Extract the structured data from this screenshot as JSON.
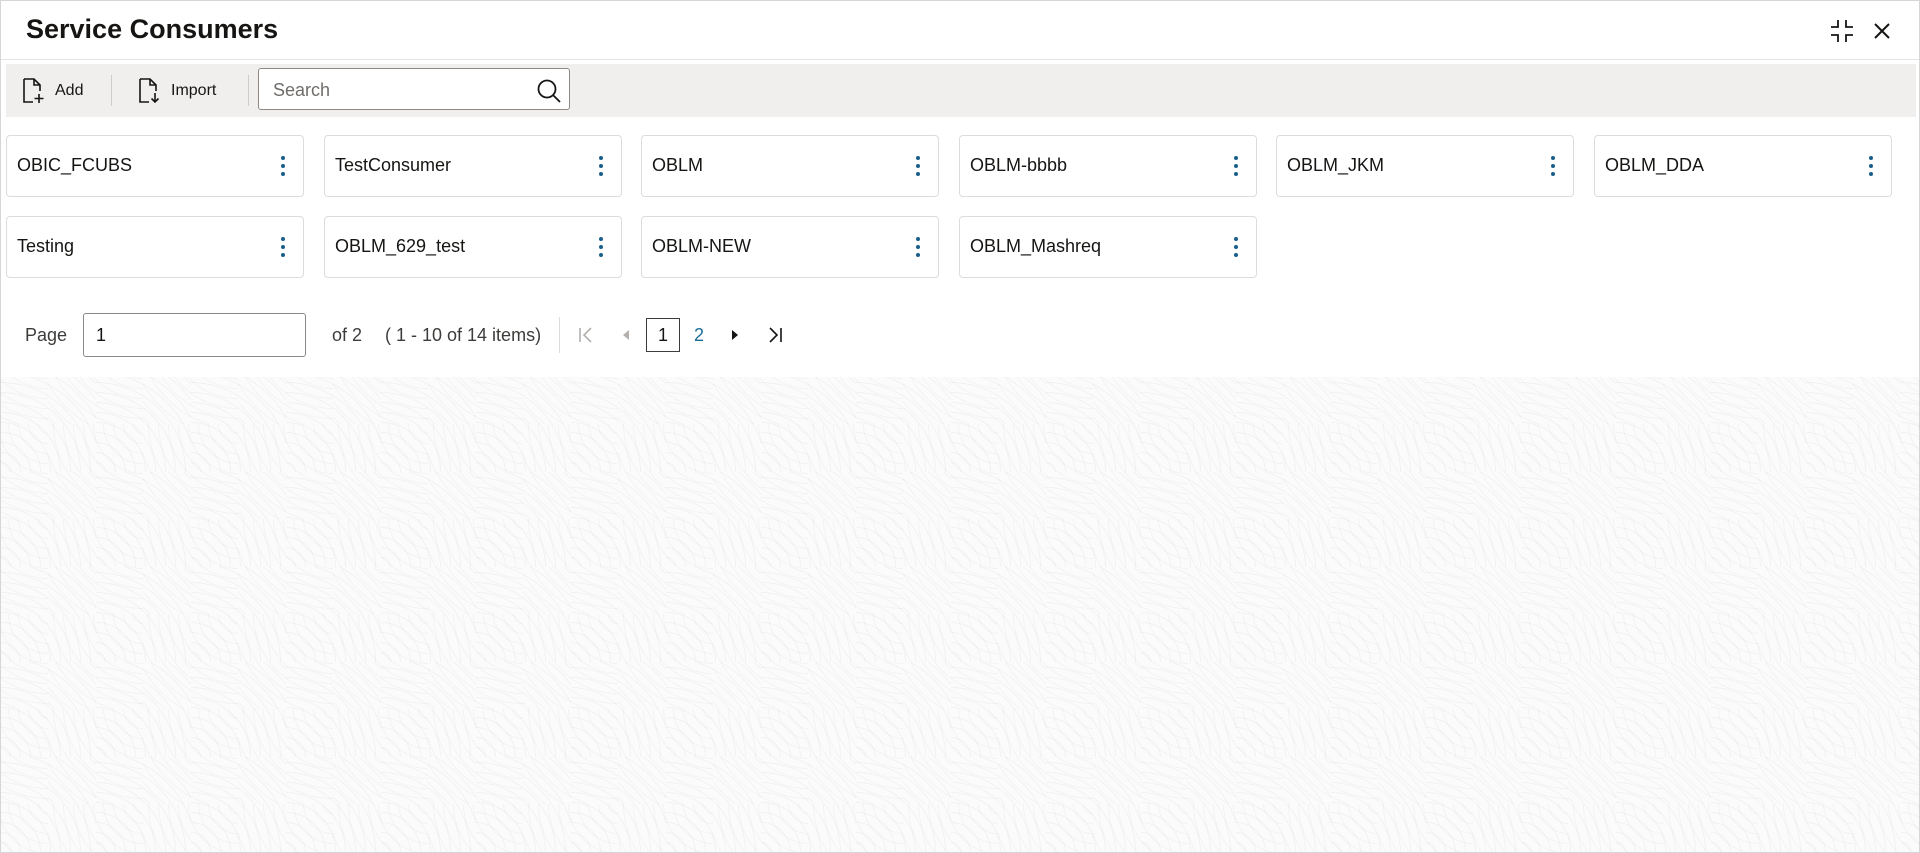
{
  "window": {
    "title": "Service Consumers",
    "controls": [
      {
        "name": "minimize-icon"
      },
      {
        "name": "close-icon"
      }
    ]
  },
  "toolbar": {
    "add_label": "Add",
    "import_label": "Import",
    "search_placeholder": "Search",
    "search_value": ""
  },
  "consumers": [
    "OBIC_FCUBS",
    "TestConsumer",
    "OBLM",
    "OBLM-bbbb",
    "OBLM_JKM",
    "OBLM_DDA",
    "Testing",
    "OBLM_629_test",
    "OBLM-NEW",
    "OBLM_Mashreq"
  ],
  "pagination": {
    "page_label": "Page",
    "page_value": "1",
    "of_text": "of 2",
    "range_text": "( 1 - 10 of 14 items)",
    "pages": [
      "1",
      "2"
    ],
    "current_page": "1"
  },
  "colors": {
    "accent": "#1a5f8b",
    "link": "#1a6e96",
    "toolbar_bg": "#f1efed",
    "text": "#161513"
  }
}
